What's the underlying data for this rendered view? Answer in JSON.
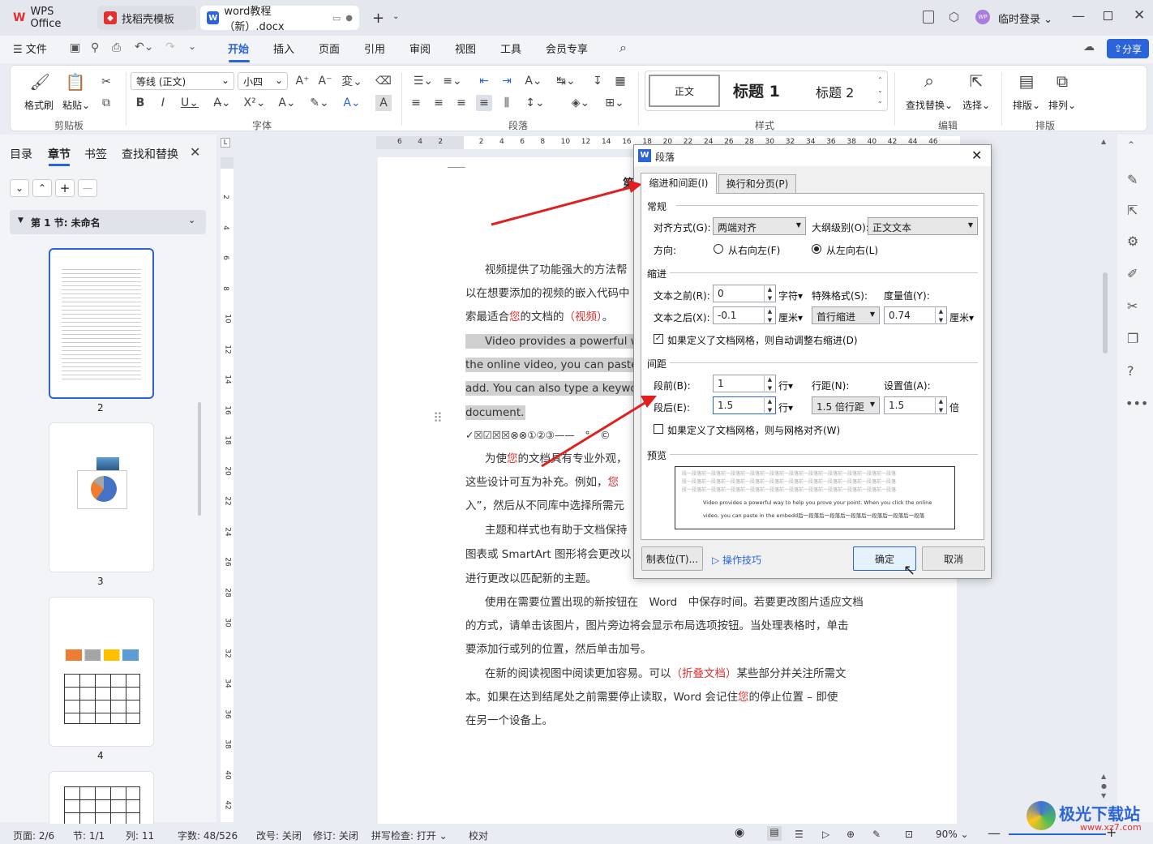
{
  "tabs": [
    {
      "label": "WPS Office"
    },
    {
      "label": "找稻壳模板"
    },
    {
      "label": "word教程（新）.docx"
    }
  ],
  "title_right": {
    "login": "临时登录"
  },
  "menu": {
    "file": "文件",
    "items": [
      "开始",
      "插入",
      "页面",
      "引用",
      "审阅",
      "视图",
      "工具",
      "会员专享"
    ],
    "share": "分享"
  },
  "ribbon": {
    "format_painter": "格式刷",
    "paste": "粘贴",
    "clipboard": "剪贴板",
    "font_name": "等线 (正文)",
    "font_size": "小四",
    "font_group": "字体",
    "paragraph_group": "段落",
    "styles": {
      "normal": "正文",
      "h1": "标题 1",
      "h2": "标题 2",
      "group": "样式"
    },
    "find_replace": "查找替换",
    "select": "选择",
    "edit_group": "编辑",
    "layout": "排版",
    "arrange": "排列",
    "layout_group": "排版"
  },
  "left": {
    "tabs": [
      "目录",
      "章节",
      "书签",
      "查找和替换"
    ],
    "section": "第 1 节: 未命名",
    "pages": [
      "2",
      "3",
      "4"
    ]
  },
  "ruler": {
    "h": [
      "6",
      "4",
      "2",
      "",
      "2",
      "4",
      "6",
      "8",
      "10",
      "12",
      "14",
      "16",
      "18",
      "20",
      "22",
      "24",
      "26",
      "28",
      "30",
      "32",
      "34",
      "36",
      "38",
      "40",
      "42",
      "44",
      "46"
    ],
    "v": [
      "2",
      "4",
      "6",
      "8",
      "10",
      "12",
      "14",
      "16",
      "18",
      "20",
      "22",
      "24",
      "26",
      "28",
      "30",
      "32",
      "34",
      "36",
      "38",
      "40",
      "42"
    ]
  },
  "doc": {
    "l1a": "视频提供了功能强大的方法帮",
    "l2": "以在想要添加的视频的嵌入代码中",
    "l3a": "索最适合",
    "l3b": "您",
    "l3c": "的文档的",
    "l3d": "（视频）",
    "l3e": "。",
    "e1": "Video provides a powerful wa",
    "e2": "the online video, you can paste in",
    "e3": "add. You can also type a keyword",
    "e4": "document.",
    "sym": "✓☒☑☒☒⊗⊗①②③——　°　©",
    "p2a": "为使",
    "p2b": "您",
    "p2c": "的文档具有专业外观，",
    "p3a": "这些设计可互为补充。例如，",
    "p3b": "您",
    "p4": "入”，然后从不同库中选择所需元",
    "p5": "主题和样式也有助于文档保持",
    "p6": "图表或 SmartArt 图形将会更改以",
    "p7": "进行更改以匹配新的主题。",
    "p8": "使用在需要位置出现的新按钮在　Word　中保存时间。若要更改图片适应文档",
    "p9": "的方式，请单击该图片，图片旁边将会显示布局选项按钮。当处理表格时，单击",
    "p10": "要添加行或列的位置，然后单击加号。",
    "p11a": "在新的阅读视图中阅读更加容易。可以",
    "p11b": "（折叠文档）",
    "p11c": "某些部分并关注所需文",
    "p12a": "本。如果在达到结尾处之前需要停止读取，Word 会记住",
    "p12b": "您",
    "p12c": "的停止位置 – 即使",
    "p13": "在另一个设备上。",
    "heading_frag": "第"
  },
  "dialog": {
    "title": "段落",
    "tab1": "缩进和间距(I)",
    "tab2": "换行和分页(P)",
    "general": "常规",
    "align_label": "对齐方式(G):",
    "align_val": "两端对齐",
    "outline_label": "大纲级别(O):",
    "outline_val": "正文文本",
    "dir_label": "方向:",
    "rtl": "从右向左(F)",
    "ltr": "从左向右(L)",
    "indent": "缩进",
    "before_label": "文本之前(R):",
    "before_val": "0",
    "before_unit": "字符▾",
    "special_label": "特殊格式(S):",
    "measure_label": "度量值(Y):",
    "after_label": "文本之后(X):",
    "after_val": "-0.1",
    "after_unit": "厘米▾",
    "special_val": "首行缩进",
    "measure_val": "0.74",
    "measure_unit": "厘米▾",
    "grid_indent": "如果定义了文档网格，则自动调整右缩进(D)",
    "spacing": "间距",
    "sb_label": "段前(B):",
    "sb_val": "1",
    "sb_unit": "行▾",
    "ls_label": "行距(N):",
    "setval_label": "设置值(A):",
    "sa_label": "段后(E):",
    "sa_val": "1.5",
    "sa_unit": "行▾",
    "ls_val": "1.5 倍行距",
    "setval_val": "1.5",
    "setval_unit": "倍",
    "grid_align": "如果定义了文档网格，则与网格对齐(W)",
    "preview": "预览",
    "prev_gray": "段一段落前一段落前一段落前一段落前一段落前一段落前一段落前一段落前一段落前一段落前一段落",
    "prev_text1": "Video provides a powerful way to help you prove your point. When you click the online",
    "prev_text2": "video, you can paste in the embedd后一段落后一段落后一段落后一段落后一段落后一段落",
    "tabs_btn": "制表位(T)...",
    "tips": "操作技巧",
    "ok": "确定",
    "cancel": "取消"
  },
  "status": {
    "page": "页面: 2/6",
    "sec": "节: 1/1",
    "col": "列: 11",
    "words": "字数: 48/526",
    "rev": "改号: 关闭",
    "track": "修订: 关闭",
    "spell": "拼写检查: 打开",
    "proof": "校对",
    "zoom": "90%"
  },
  "watermark": {
    "cn": "极光下载站",
    "url": "www.xz7.com"
  }
}
